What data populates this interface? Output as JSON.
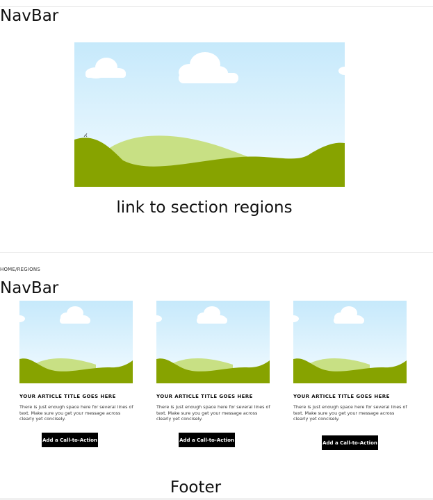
{
  "top_navbar": {
    "label": "NavBar"
  },
  "hero": {
    "image_alt": "landscape illustration",
    "link_text": "link to section regions"
  },
  "breadcrumb": {
    "text": "HOME/REGIONS"
  },
  "second_navbar": {
    "label": "NavBar"
  },
  "cards": [
    {
      "title": "YOUR ARTICLE TITLE GOES HERE",
      "body": "There is just enough space here for several lines of text. Make sure you get your message across clearly yet concisely.",
      "cta_label": "Add a Call-to-Action"
    },
    {
      "title": "YOUR ARTICLE TITLE GOES HERE",
      "body": "There is just enough space here for several lines of text. Make sure you get your message across clearly yet concisely.",
      "cta_label": "Add a Call-to-Action"
    },
    {
      "title": "YOUR ARTICLE TITLE GOES HERE",
      "body": "There is just enough space here for several lines of text. Make sure you get your message across clearly yet concisely.",
      "cta_label": "Add a Call-to-Action"
    }
  ],
  "footer": {
    "label": "Footer"
  },
  "colors": {
    "sky_top": "#c6e9fb",
    "sky_bottom": "#eef9ff",
    "hill_dark": "#87a300",
    "hill_light": "#c8e084",
    "cloud": "#ffffff",
    "cta_background": "#000000"
  }
}
